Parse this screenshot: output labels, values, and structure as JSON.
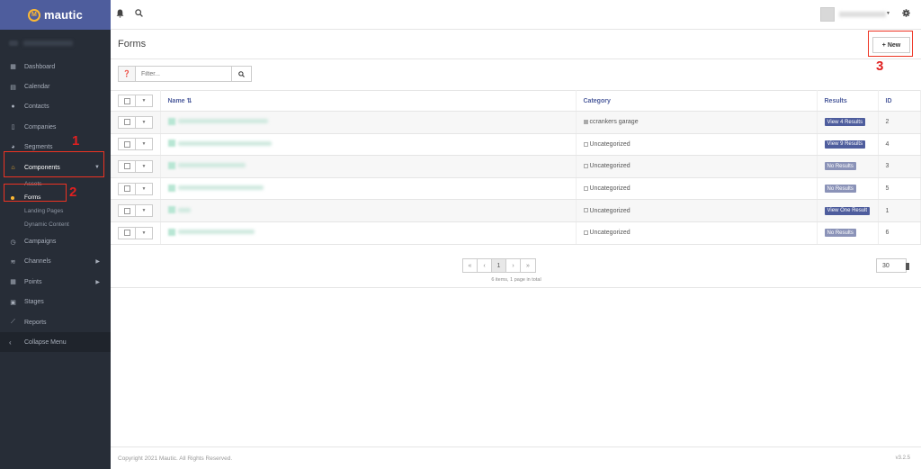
{
  "brand": {
    "name": "mautic",
    "logo_letter": "M"
  },
  "sidebar": {
    "items": [
      {
        "label": "Dashboard",
        "icon": "th"
      },
      {
        "label": "Calendar",
        "icon": "▦"
      },
      {
        "label": "Contacts",
        "icon": "●"
      },
      {
        "label": "Companies",
        "icon": "▤"
      },
      {
        "label": "Segments",
        "icon": "◕"
      },
      {
        "label": "Components",
        "icon": "⌂"
      },
      {
        "label": "Campaigns",
        "icon": "◷"
      },
      {
        "label": "Channels",
        "icon": "≋"
      },
      {
        "label": "Points",
        "icon": "▦"
      },
      {
        "label": "Stages",
        "icon": "▣"
      },
      {
        "label": "Reports",
        "icon": "⟋"
      }
    ],
    "sub_items": [
      "Assets",
      "Forms",
      "Landing Pages",
      "Dynamic Content"
    ],
    "collapse_label": "Collapse Menu"
  },
  "topbar": {
    "bell_icon": "bell-icon",
    "search_icon": "search-icon"
  },
  "page": {
    "title": "Forms",
    "new_label": "New"
  },
  "filter": {
    "placeholder": "Filter..."
  },
  "table": {
    "headers": {
      "name": "Name",
      "category": "Category",
      "results": "Results",
      "id": "ID"
    },
    "rows": [
      {
        "category": "ccrankers garage",
        "results": "View 4 Results",
        "id": "2"
      },
      {
        "category": "Uncategorized",
        "results": "View 9 Results",
        "id": "4"
      },
      {
        "category": "Uncategorized",
        "results": "No Results",
        "id": "3"
      },
      {
        "category": "Uncategorized",
        "results": "No Results",
        "id": "5"
      },
      {
        "category": "Uncategorized",
        "results": "View One Result",
        "id": "1"
      },
      {
        "category": "Uncategorized",
        "results": "No Results",
        "id": "6"
      }
    ]
  },
  "pagination": {
    "first": "«",
    "prev": "‹",
    "current": "1",
    "next": "›",
    "last": "»",
    "info": "6 items, 1 page in total",
    "per_page": "30"
  },
  "annotations": {
    "one": "1",
    "two": "2",
    "three": "3"
  },
  "footer": {
    "copyright": "Copyright 2021 Mautic. All Rights Reserved.",
    "version": "v3.2.5"
  },
  "colors": {
    "brand": "#4e5d9d",
    "sidebar": "#272d37",
    "accent": "#fdb933",
    "annotation": "#e02020"
  }
}
